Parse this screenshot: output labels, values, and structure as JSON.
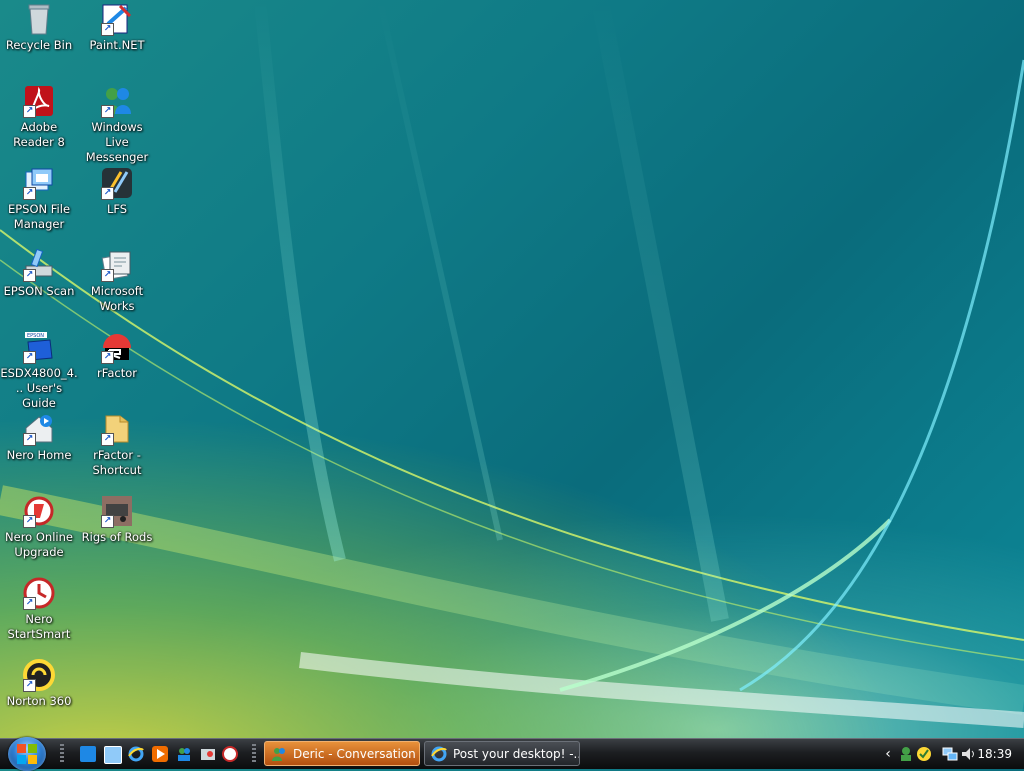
{
  "desktop": {
    "icons": [
      {
        "label": "Recycle Bin",
        "icon": "recycle-bin-icon"
      },
      {
        "label": "Paint.NET",
        "icon": "paint-net-icon"
      },
      {
        "label": "Adobe Reader 8",
        "icon": "adobe-reader-icon"
      },
      {
        "label": "Windows Live Messenger",
        "icon": "messenger-icon"
      },
      {
        "label": "EPSON File Manager",
        "icon": "epson-file-manager-icon"
      },
      {
        "label": "LFS",
        "icon": "lfs-icon"
      },
      {
        "label": "EPSON Scan",
        "icon": "epson-scan-icon"
      },
      {
        "label": "Microsoft Works",
        "icon": "microsoft-works-icon"
      },
      {
        "label": "ESDX4800_4... User's Guide",
        "icon": "epson-guide-icon"
      },
      {
        "label": "rFactor",
        "icon": "rfactor-icon"
      },
      {
        "label": "Nero Home",
        "icon": "nero-home-icon"
      },
      {
        "label": "rFactor - Shortcut",
        "icon": "folder-icon"
      },
      {
        "label": "Nero Online Upgrade",
        "icon": "nero-upgrade-icon"
      },
      {
        "label": "Rigs of Rods",
        "icon": "rigs-of-rods-icon"
      },
      {
        "label": "Nero StartSmart",
        "icon": "nero-startsmart-icon"
      },
      {
        "label": "Norton 360",
        "icon": "norton-icon"
      }
    ]
  },
  "taskbar": {
    "tasks": [
      {
        "label": "Deric - Conversation",
        "icon": "messenger-icon",
        "active": true
      },
      {
        "label": "Post your desktop! -...",
        "icon": "internet-explorer-icon",
        "active": false
      }
    ],
    "clock": "18:39",
    "colors": {
      "active_task": "#c7681a",
      "inactive_task": "#3a3d42"
    }
  }
}
